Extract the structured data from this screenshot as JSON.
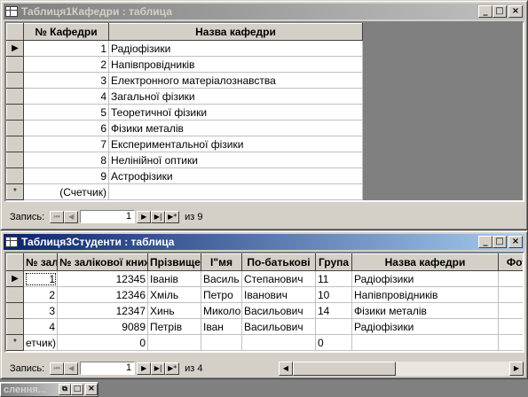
{
  "window1": {
    "title": "Таблиця1Кафедри : таблица",
    "columns": [
      "№ Кафедри",
      "Назва кафедри"
    ],
    "rows": [
      {
        "id": "1",
        "name": "Радіофізики"
      },
      {
        "id": "2",
        "name": "Напівпровідників"
      },
      {
        "id": "3",
        "name": "Електронного матеріалознавства"
      },
      {
        "id": "4",
        "name": "Загальної фізики"
      },
      {
        "id": "5",
        "name": "Теоретичної фізики"
      },
      {
        "id": "6",
        "name": "Фізики металів"
      },
      {
        "id": "7",
        "name": "Експериментальної фізики"
      },
      {
        "id": "8",
        "name": "Нелінійної оптики"
      },
      {
        "id": "9",
        "name": "Астрофізики"
      }
    ],
    "new_row": {
      "id": "(Счетчик)",
      "name": ""
    },
    "nav": {
      "label": "Запись:",
      "current": "1",
      "of_text": "из 9"
    }
  },
  "window2": {
    "title": "Таблиця3Студенти : таблица",
    "columns": [
      "№ зал",
      "№ залікової книж",
      "Прізвище",
      "І\"мя",
      "По-батькові",
      "Група",
      "Назва кафедри",
      "Фот"
    ],
    "rows": [
      {
        "c1": "1",
        "c2": "12345",
        "c3": "Іванів",
        "c4": "Василь",
        "c5": "Степанович",
        "c6": "11",
        "c7": "Радіофізики",
        "c8": ""
      },
      {
        "c1": "2",
        "c2": "12346",
        "c3": "Хміль",
        "c4": "Петро",
        "c5": "Іванович",
        "c6": "10",
        "c7": "Напівпровідників",
        "c8": ""
      },
      {
        "c1": "3",
        "c2": "12347",
        "c3": "Хинь",
        "c4": "Миколо",
        "c5": "Васильович",
        "c6": "14",
        "c7": "Фізики металів",
        "c8": ""
      },
      {
        "c1": "4",
        "c2": "9089",
        "c3": "Петрів",
        "c4": "Іван",
        "c5": "Васильович",
        "c6": "",
        "c7": "Радіофізики",
        "c8": ""
      }
    ],
    "new_row": {
      "c1": "етчик)",
      "c2": "0",
      "c6": "0"
    },
    "nav": {
      "label": "Запись:",
      "current": "1",
      "of_text": "из 4"
    }
  },
  "taskbar": {
    "minimized_title": "слення..."
  },
  "icons": {
    "nav_first": "⏮",
    "nav_prev": "◀",
    "nav_next": "▶",
    "nav_last": "▶|",
    "nav_new": "▶*",
    "minimize": "_",
    "maximize": "□",
    "close": "×",
    "row_selector": "▶",
    "new_row_marker": "*"
  }
}
